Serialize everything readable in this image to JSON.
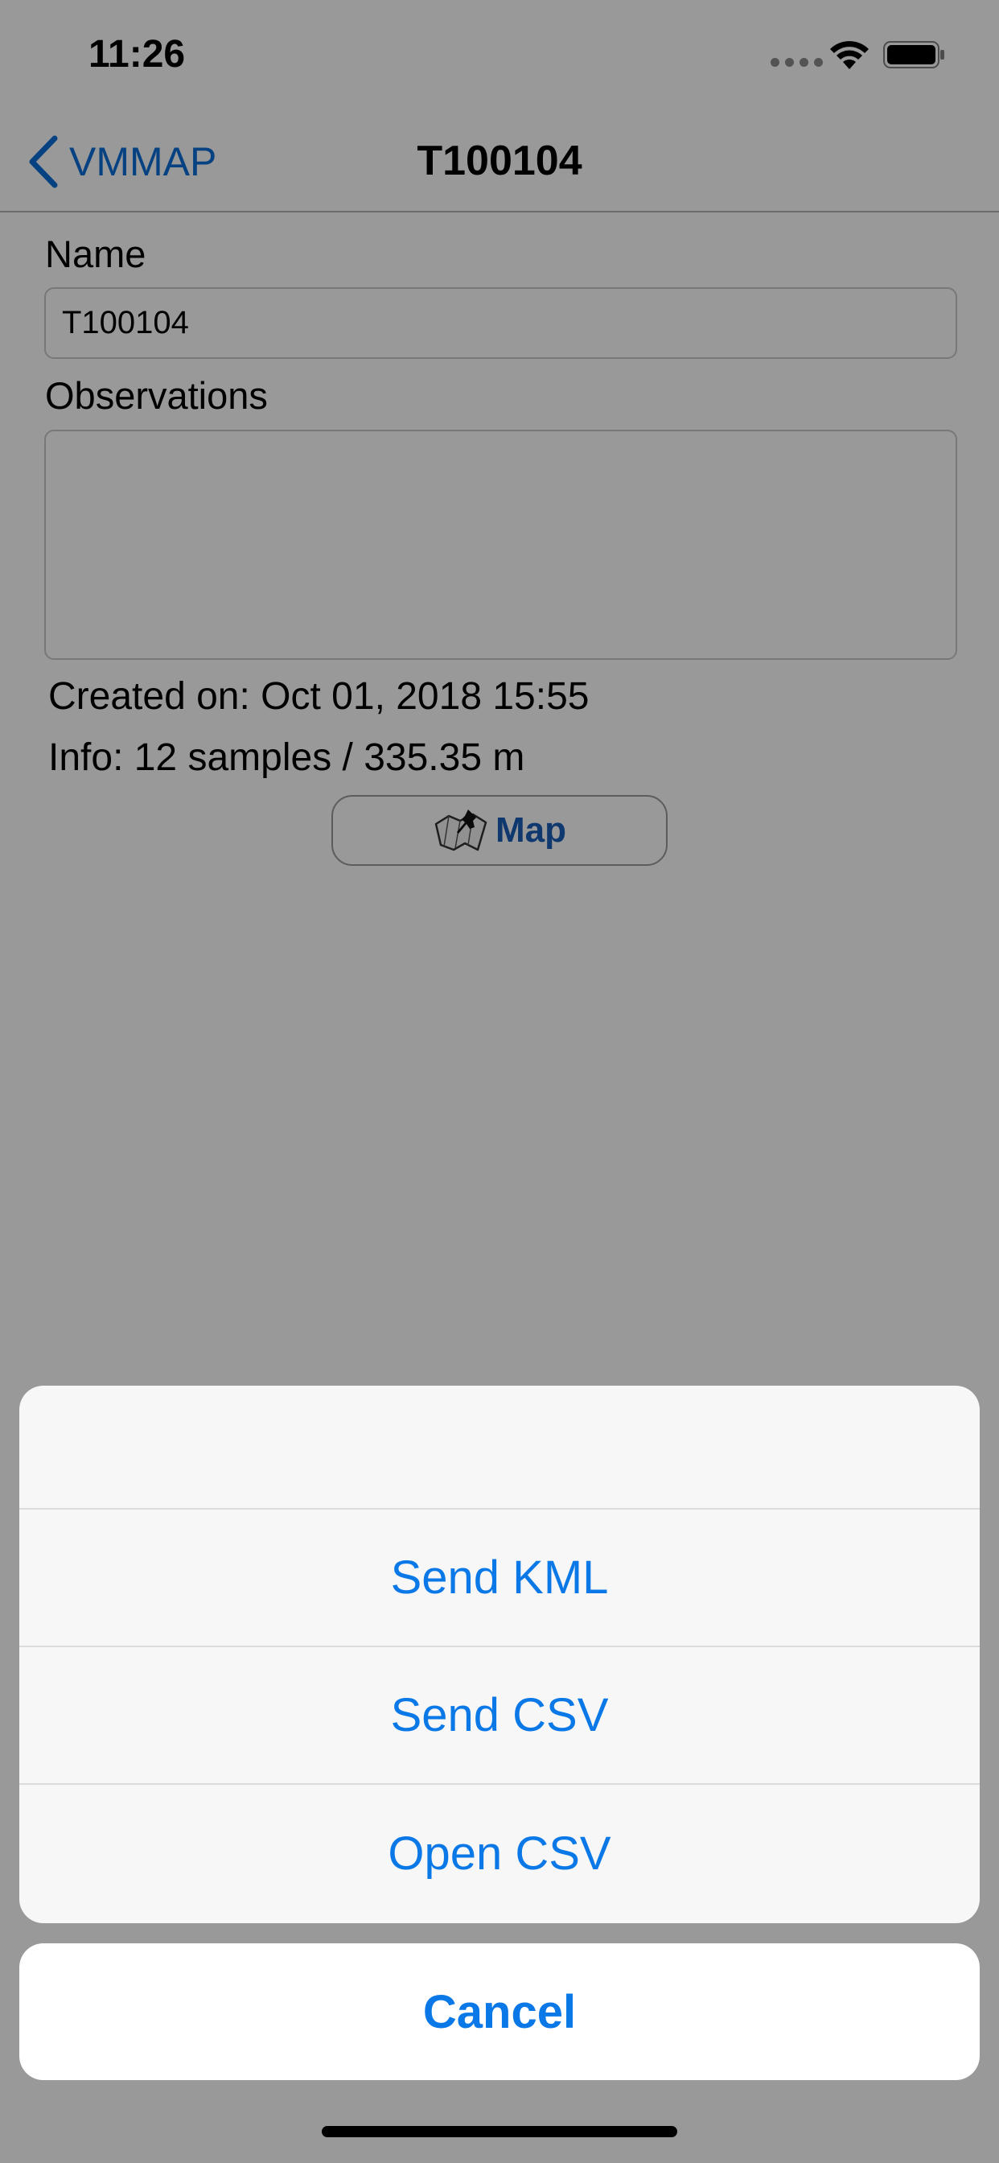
{
  "status_bar": {
    "time": "11:26"
  },
  "nav": {
    "back_label": "VMMAP",
    "title": "T100104"
  },
  "form": {
    "name_label": "Name",
    "name_value": "T100104",
    "observations_label": "Observations",
    "observations_value": "",
    "created_on": "Created on: Oct 01, 2018 15:55",
    "info": "Info: 12 samples / 335.35 m",
    "map_button_label": "Map"
  },
  "action_sheet": {
    "actions": [
      {
        "label": "Send KML"
      },
      {
        "label": "Send CSV"
      },
      {
        "label": "Open CSV"
      }
    ],
    "cancel_label": "Cancel"
  },
  "colors": {
    "accent": "#0a78e6",
    "overlay": "rgba(0,0,0,0.4)"
  }
}
